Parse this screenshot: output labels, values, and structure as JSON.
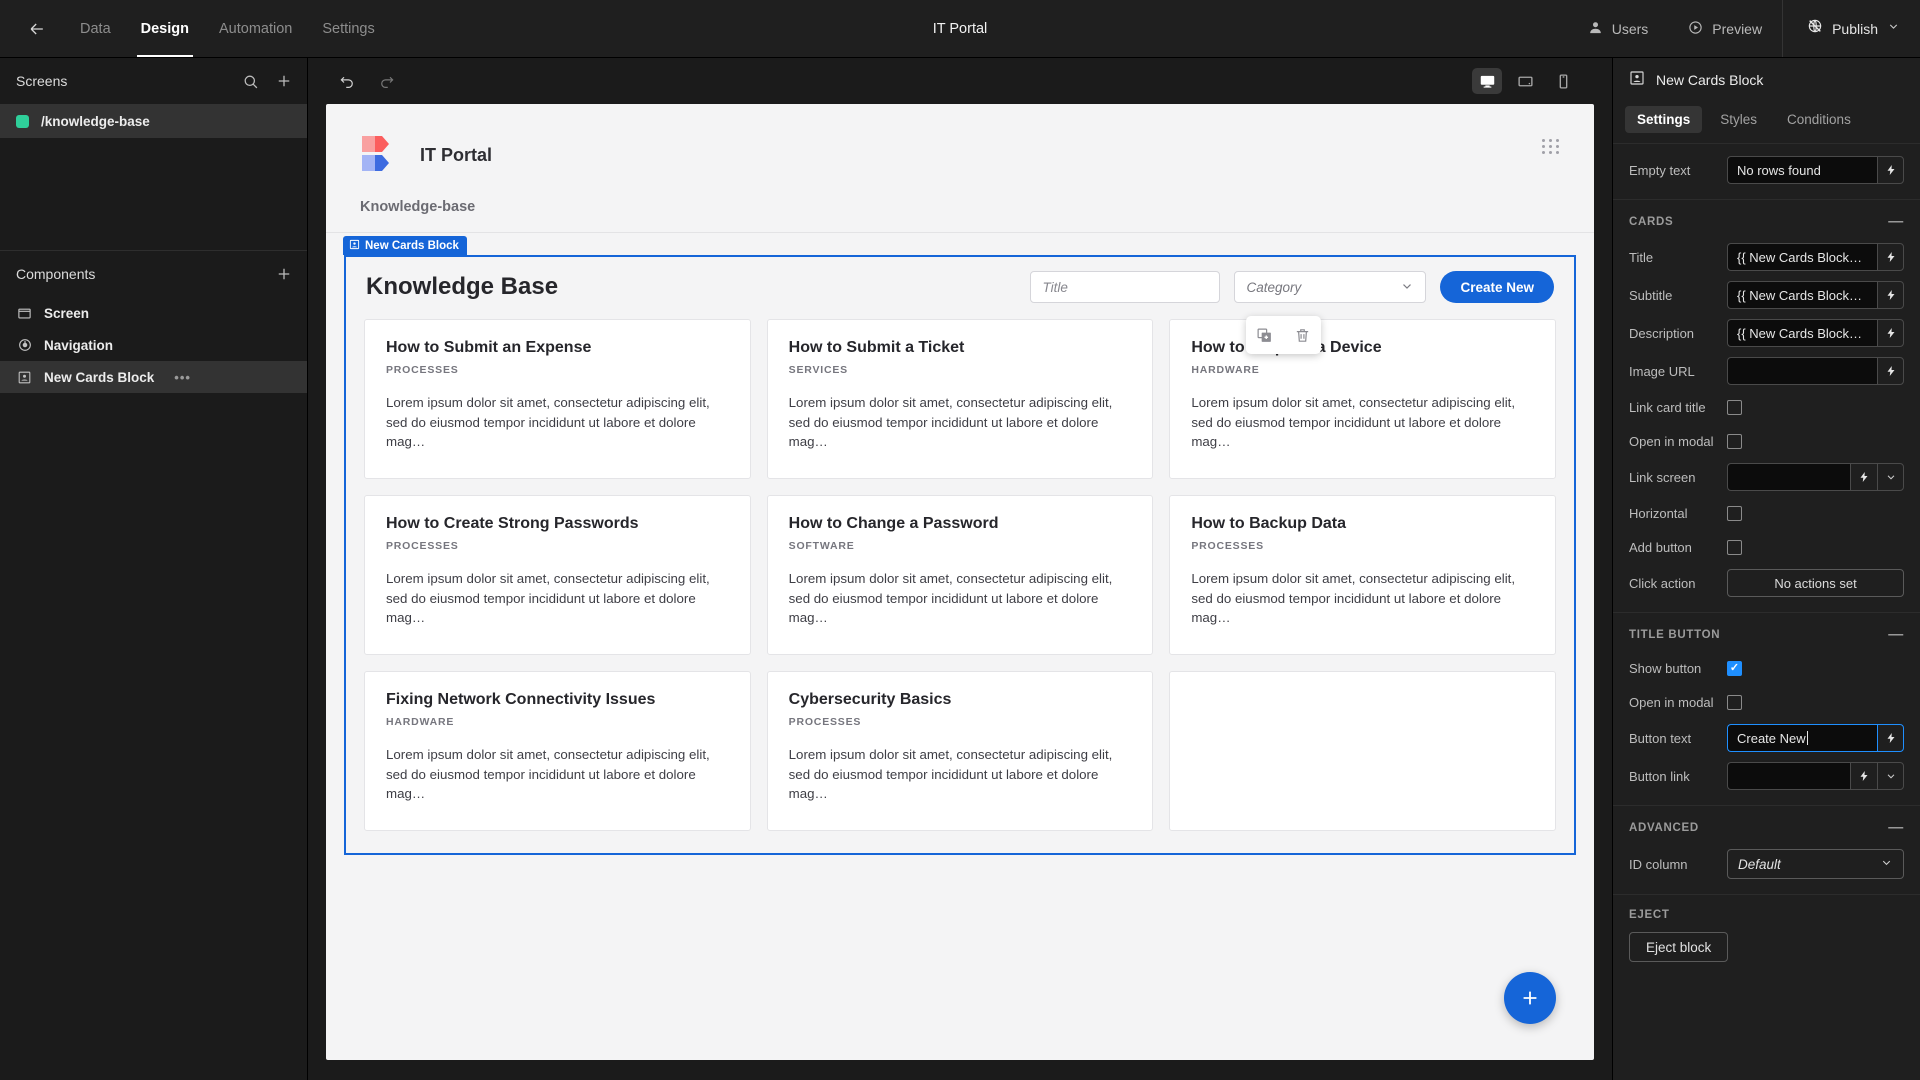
{
  "topbar": {
    "back_icon": "arrow-left-icon",
    "tabs": [
      {
        "label": "Data",
        "active": false
      },
      {
        "label": "Design",
        "active": true
      },
      {
        "label": "Automation",
        "active": false
      },
      {
        "label": "Settings",
        "active": false
      }
    ],
    "title": "IT Portal",
    "users_label": "Users",
    "preview_label": "Preview",
    "publish_label": "Publish"
  },
  "left_panel": {
    "screens_header": "Screens",
    "screens": [
      {
        "label": "/knowledge-base",
        "color": "#2fcf9a",
        "selected": true
      }
    ],
    "components_header": "Components",
    "components": [
      {
        "label": "Screen",
        "icon": "screen-icon",
        "selected": false,
        "more": ""
      },
      {
        "label": "Navigation",
        "icon": "navigation-icon",
        "selected": false,
        "more": ""
      },
      {
        "label": "New Cards Block",
        "icon": "cards-block-icon",
        "selected": true,
        "more": "•••"
      }
    ]
  },
  "center": {
    "undo_icon": "undo-icon",
    "redo_icon": "redo-icon",
    "devices": [
      {
        "name": "desktop",
        "active": true
      },
      {
        "name": "tablet",
        "active": false
      },
      {
        "name": "mobile",
        "active": false
      }
    ],
    "app": {
      "brand_name": "IT Portal",
      "nav_link": "Knowledge-base"
    },
    "float_tools": [
      {
        "name": "duplicate-icon"
      },
      {
        "name": "delete-icon"
      }
    ],
    "block": {
      "tag_label": "New Cards Block",
      "heading": "Knowledge Base",
      "title_placeholder": "Title",
      "category_placeholder": "Category",
      "create_button": "Create New"
    },
    "cards": [
      {
        "title": "How to Submit an Expense",
        "category": "PROCESSES",
        "description": "Lorem ipsum dolor sit amet, consectetur adipiscing elit, sed do eiusmod tempor incididunt ut labore et dolore mag…"
      },
      {
        "title": "How to Submit a Ticket",
        "category": "SERVICES",
        "description": "Lorem ipsum dolor sit amet, consectetur adipiscing elit, sed do eiusmod tempor incididunt ut labore et dolore mag…"
      },
      {
        "title": "How to Request a Device",
        "category": "HARDWARE",
        "description": "Lorem ipsum dolor sit amet, consectetur adipiscing elit, sed do eiusmod tempor incididunt ut labore et dolore mag…"
      },
      {
        "title": "How to Create Strong Passwords",
        "category": "PROCESSES",
        "description": "Lorem ipsum dolor sit amet, consectetur adipiscing elit, sed do eiusmod tempor incididunt ut labore et dolore mag…"
      },
      {
        "title": "How to Change a Password",
        "category": "SOFTWARE",
        "description": "Lorem ipsum dolor sit amet, consectetur adipiscing elit, sed do eiusmod tempor incididunt ut labore et dolore mag…"
      },
      {
        "title": "How to Backup Data",
        "category": "PROCESSES",
        "description": "Lorem ipsum dolor sit amet, consectetur adipiscing elit, sed do eiusmod tempor incididunt ut labore et dolore mag…"
      },
      {
        "title": "Fixing Network Connectivity Issues",
        "category": "HARDWARE",
        "description": "Lorem ipsum dolor sit amet, consectetur adipiscing elit, sed do eiusmod tempor incididunt ut labore et dolore mag…"
      },
      {
        "title": "Cybersecurity Basics",
        "category": "PROCESSES",
        "description": "Lorem ipsum dolor sit amet, consectetur adipiscing elit, sed do eiusmod tempor incididunt ut labore et dolore mag…"
      }
    ],
    "fab_icon": "plus-icon"
  },
  "right_panel": {
    "title": "New Cards Block",
    "tabs": [
      {
        "label": "Settings",
        "active": true
      },
      {
        "label": "Styles",
        "active": false
      },
      {
        "label": "Conditions",
        "active": false
      }
    ],
    "empty_text_label": "Empty text",
    "empty_text_value": "No rows found",
    "sections": {
      "cards": {
        "header": "CARDS",
        "title_label": "Title",
        "title_value": "{{ New Cards Block…",
        "subtitle_label": "Subtitle",
        "subtitle_value": "{{ New Cards Block…",
        "description_label": "Description",
        "description_value": "{{ New Cards Block…",
        "image_url_label": "Image URL",
        "image_url_value": "",
        "link_card_title_label": "Link card title",
        "link_card_title_checked": false,
        "open_in_modal_label": "Open in modal",
        "open_in_modal_checked": false,
        "link_screen_label": "Link screen",
        "link_screen_value": "",
        "horizontal_label": "Horizontal",
        "horizontal_checked": false,
        "add_button_label": "Add button",
        "add_button_checked": false,
        "click_action_label": "Click action",
        "click_action_value": "No actions set"
      },
      "title_button": {
        "header": "TITLE BUTTON",
        "show_button_label": "Show button",
        "show_button_checked": true,
        "open_in_modal_label": "Open in modal",
        "open_in_modal_checked": false,
        "button_text_label": "Button text",
        "button_text_value": "Create New",
        "button_link_label": "Button link",
        "button_link_value": ""
      },
      "advanced": {
        "header": "ADVANCED",
        "id_column_label": "ID column",
        "id_column_value": "Default"
      },
      "eject": {
        "header": "EJECT",
        "button_label": "Eject block"
      }
    }
  },
  "colors": {
    "accent": "#1565d8",
    "checkbox_on": "#1f8fff",
    "screen_dot": "#2fcf9a"
  }
}
